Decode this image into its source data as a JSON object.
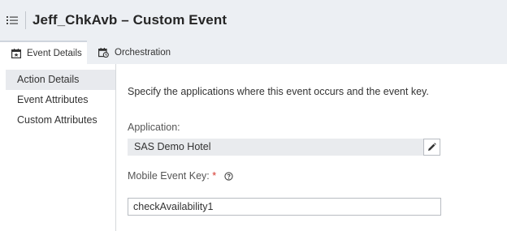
{
  "header": {
    "title": "Jeff_ChkAvb – Custom Event",
    "menu_icon": "list-menu-icon"
  },
  "tabs": [
    {
      "label": "Event Details",
      "icon": "calendar-star-icon",
      "active": true
    },
    {
      "label": "Orchestration",
      "icon": "calendar-clock-icon",
      "active": false
    }
  ],
  "sidebar": {
    "items": [
      {
        "label": "Action Details",
        "active": true
      },
      {
        "label": "Event Attributes",
        "active": false
      },
      {
        "label": "Custom Attributes",
        "active": false
      }
    ]
  },
  "main": {
    "intro": "Specify the applications where this event occurs and the event key.",
    "application": {
      "label": "Application:",
      "value": "SAS Demo Hotel",
      "edit_icon": "pencil-icon"
    },
    "event_key": {
      "label": "Mobile Event Key:",
      "required_mark": "*",
      "help_icon": "question-circle-icon",
      "value": "checkAvailability1"
    }
  },
  "colors": {
    "header_bg": "#eceff3",
    "required": "#d4342b",
    "active_item_bg": "#e8eaee"
  }
}
